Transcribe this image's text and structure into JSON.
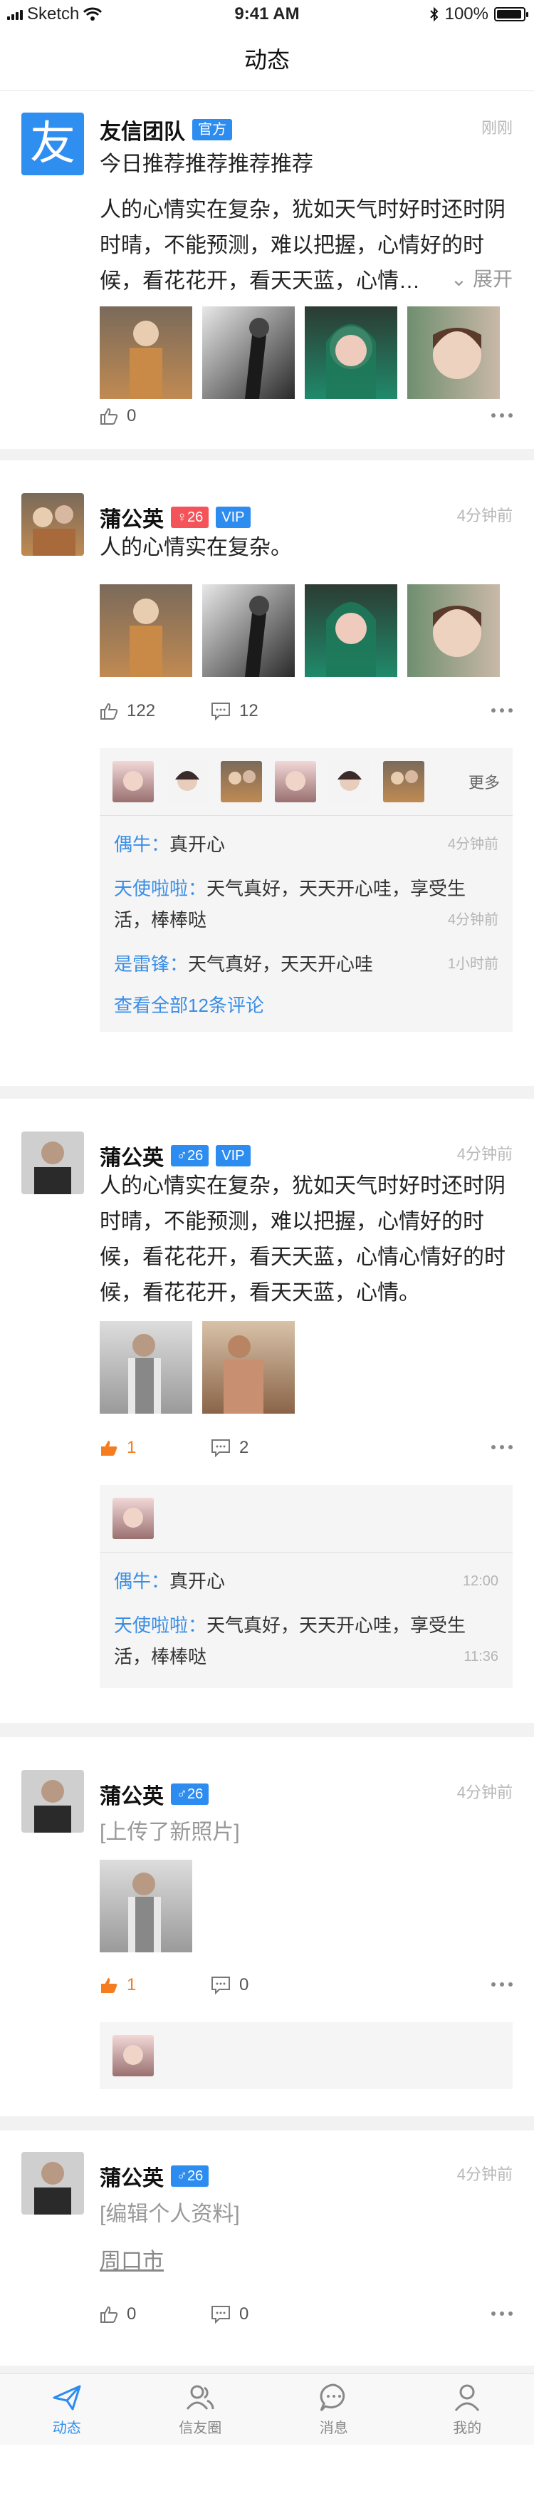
{
  "statusbar": {
    "carrier": "Sketch",
    "time": "9:41 AM",
    "battery": "100%"
  },
  "navbar": {
    "title": "动态"
  },
  "posts": [
    {
      "name": "友信团队",
      "logo_char": "友",
      "badges": [
        "官方"
      ],
      "time": "刚刚",
      "title": "今日推荐推荐推荐推荐",
      "text_lines": [
        "人的心情实在复杂，犹如天气时好时还时阴",
        "时晴，不能预测，难以把握，心情好的时",
        "候，看花花开，看天天蓝，心情…"
      ],
      "expand_label": "展开",
      "likes": "0"
    },
    {
      "name": "蒲公英",
      "badges": [
        "♀26",
        "VIP"
      ],
      "time": "4分钟前",
      "text_lines": [
        "人的心情实在复杂。"
      ],
      "likes": "122",
      "comments_count": "12",
      "more_likers": "更多",
      "comments": [
        {
          "who": "偶牛：",
          "text": "真开心",
          "time": "4分钟前"
        },
        {
          "who": "天使啦啦：",
          "text": "天气真好，天天开心哇，享受生",
          "text2": "活，棒棒哒",
          "time": "4分钟前"
        },
        {
          "who": "是雷锋：",
          "text": "天气真好，天天开心哇",
          "time": "1小时前"
        }
      ],
      "view_all": "查看全部12条评论"
    },
    {
      "name": "蒲公英",
      "badges": [
        "♂26",
        "VIP"
      ],
      "time": "4分钟前",
      "text_lines": [
        "人的心情实在复杂，犹如天气时好时还时阴",
        "时晴，不能预测，难以把握，心情好的时",
        "候，看花花开，看天天蓝，心情心情好的时",
        "候，看花花开，看天天蓝，心情。"
      ],
      "likes": "1",
      "comments_count": "2",
      "comments": [
        {
          "who": "偶牛：",
          "text": "真开心",
          "time": "12:00"
        },
        {
          "who": "天使啦啦：",
          "text": "天气真好，天天开心哇，享受生",
          "text2": "活，棒棒哒",
          "time": "11:36"
        }
      ]
    },
    {
      "name": "蒲公英",
      "badges": [
        "♂26"
      ],
      "time": "4分钟前",
      "note": "[上传了新照片]",
      "likes": "1",
      "comments_count": "0"
    },
    {
      "name": "蒲公英",
      "badges": [
        "♂26"
      ],
      "time": "4分钟前",
      "note": "[编辑个人资料]",
      "link": "周口市",
      "likes": "0",
      "comments_count": "0"
    }
  ],
  "tabbar": [
    {
      "label": "动态",
      "icon": "paper-plane-icon",
      "active": true
    },
    {
      "label": "信友圈",
      "icon": "friends-icon",
      "active": false
    },
    {
      "label": "消息",
      "icon": "chat-icon",
      "active": false
    },
    {
      "label": "我的",
      "icon": "person-icon",
      "active": false
    }
  ],
  "colors": {
    "accent": "#2d8cf0",
    "badge_female": "#f5535a",
    "liked": "#f57c1f",
    "link": "#3a8ee6"
  }
}
